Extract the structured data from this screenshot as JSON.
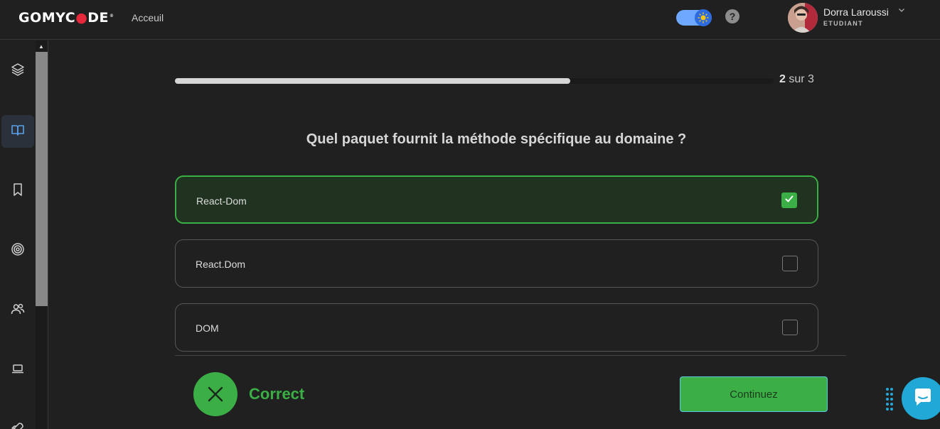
{
  "header": {
    "logo_text_before": "GOMYC",
    "logo_text_after": "DE",
    "logo_registered": "®",
    "nav_home": "Acceuil",
    "help_symbol": "?",
    "user_name": "Dorra Laroussi",
    "user_role": "ETUDIANT",
    "accent_color": "#3bae45"
  },
  "sidebar": {
    "items": [
      {
        "icon": "layers-icon"
      },
      {
        "icon": "book-open-icon",
        "active": true
      },
      {
        "icon": "bookmark-icon"
      },
      {
        "icon": "target-icon"
      },
      {
        "icon": "users-icon"
      },
      {
        "icon": "laptop-icon"
      },
      {
        "icon": "rocket-icon"
      }
    ]
  },
  "quiz": {
    "progress_current": "2",
    "progress_separator": "sur",
    "progress_total": "3",
    "progress_fraction": 0.66,
    "question": "Quel paquet fournit la méthode spécifique au domaine ?",
    "options": [
      {
        "label": "React-Dom",
        "checked": true
      },
      {
        "label": "React.Dom",
        "checked": false
      },
      {
        "label": "DOM",
        "checked": false
      }
    ],
    "result_text": "Correct",
    "continue_label": "Continuez"
  }
}
